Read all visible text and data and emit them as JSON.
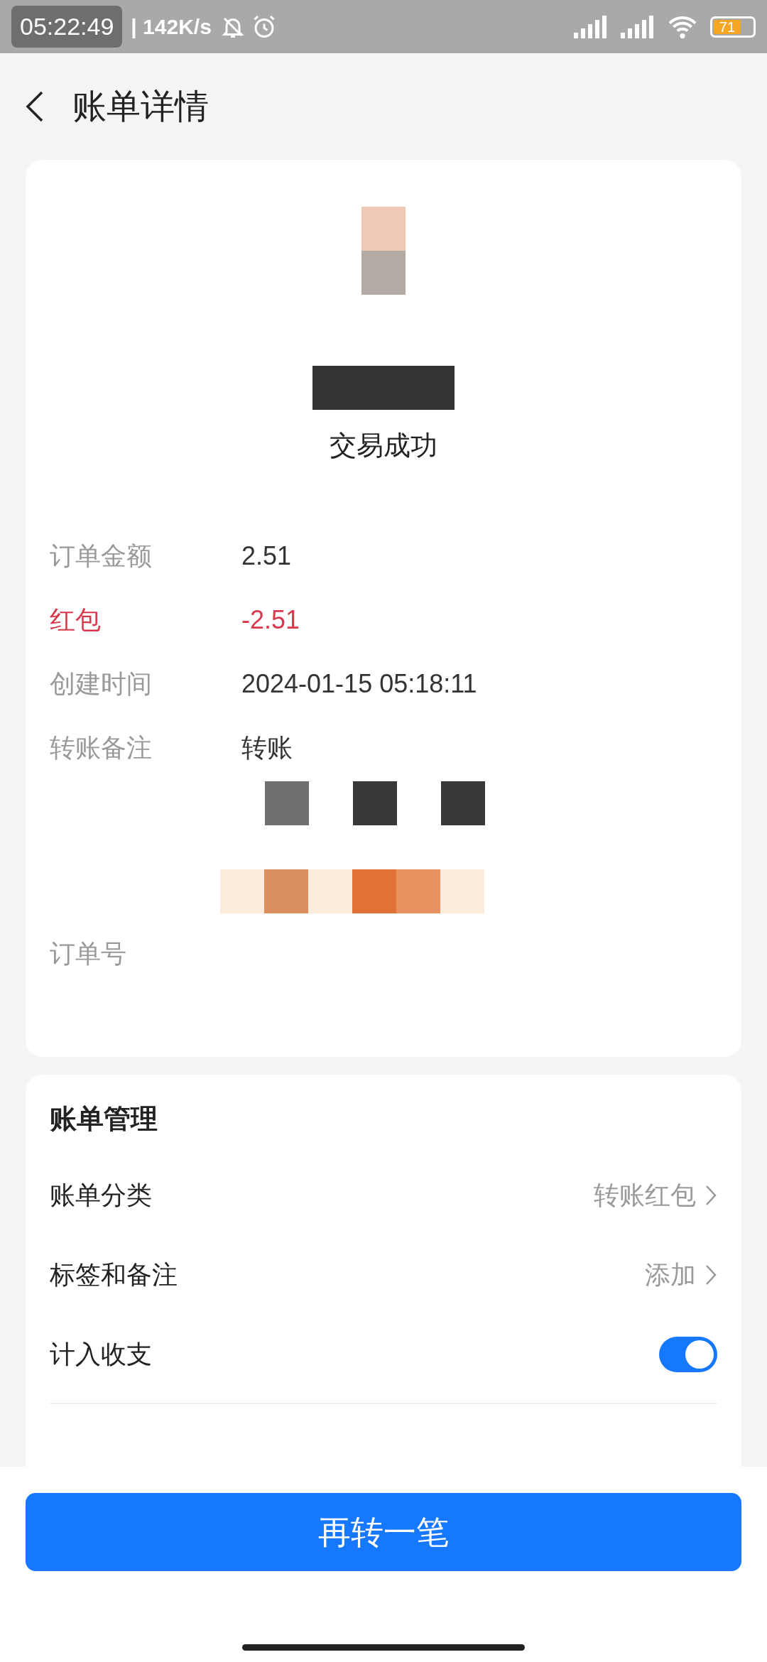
{
  "status_bar": {
    "time_overlay": "05:22:49",
    "network_speed": "| 142K/s",
    "battery": "71"
  },
  "header": {
    "title": "账单详情"
  },
  "summary": {
    "status": "交易成功"
  },
  "details": [
    {
      "label": "订单金额",
      "value": "2.51",
      "highlight": false
    },
    {
      "label": "红包",
      "value": "-2.51",
      "highlight": true
    },
    {
      "label": "创建时间",
      "value": "2024-01-15 05:18:11",
      "highlight": false
    },
    {
      "label": "转账备注",
      "value": "转账",
      "highlight": false
    }
  ],
  "order_number": {
    "label": "订单号"
  },
  "bill_management": {
    "title": "账单管理",
    "rows": [
      {
        "kind": "link",
        "label": "账单分类",
        "value": "转账红包"
      },
      {
        "kind": "link",
        "label": "标签和备注",
        "value": "添加"
      },
      {
        "kind": "toggle",
        "label": "计入收支",
        "on": true
      }
    ]
  },
  "footer": {
    "button": "再转一笔"
  }
}
